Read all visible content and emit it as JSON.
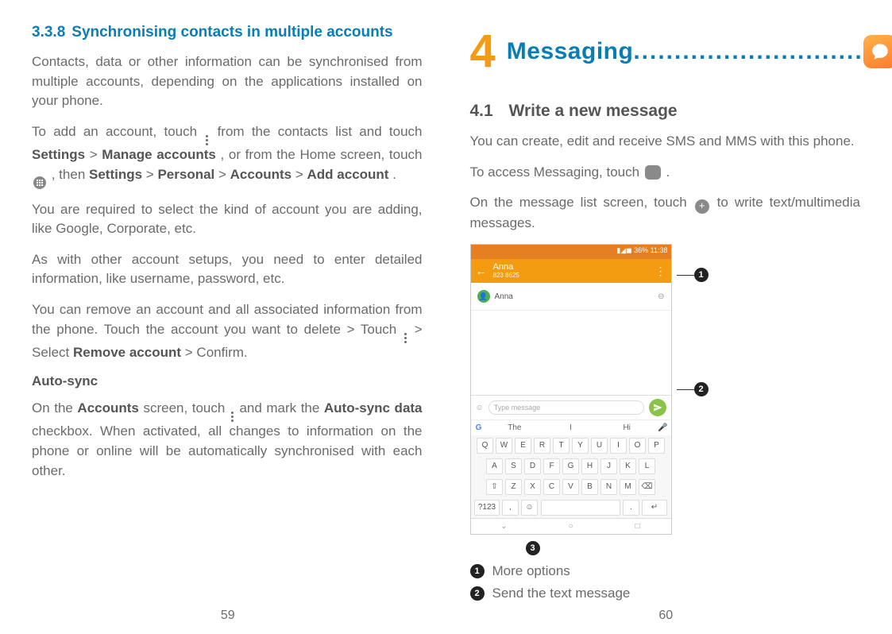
{
  "left": {
    "section_number": "3.3.8",
    "section_title": "Synchronising contacts in multiple accounts",
    "p1": "Contacts, data or other information can be synchronised from multiple accounts, depending on the applications installed on your phone.",
    "p2a": "To add an account, touch ",
    "p2b": " from the contacts list and touch ",
    "p2_settings": "Settings",
    "p2_gt1": " > ",
    "p2_manage": "Manage accounts",
    "p2c": ", or from the Home screen, touch ",
    "p2d": ", then ",
    "p2_settings2": "Settings",
    "p2_gt2": " > ",
    "p2_personal": "Personal",
    "p2_gt3": " > ",
    "p2_accounts": "Accounts",
    "p2_gt4": " > ",
    "p2_add": "Add account",
    "p2_end": ".",
    "p3": "You are required to select the kind of account you are adding, like Google, Corporate, etc.",
    "p4": "As with other account setups, you need to enter detailed information, like username, password, etc.",
    "p5a": "You can remove an account and all associated information from the phone. Touch the account you want to delete > Touch ",
    "p5b": " > Select ",
    "p5_remove": "Remove account",
    "p5c": " > Confirm.",
    "autosync_title": "Auto-sync",
    "p6a": "On the ",
    "p6_accounts": "Accounts",
    "p6b": " screen, touch ",
    "p6c": " and mark the ",
    "p6_autosync": "Auto-sync data",
    "p6d": " checkbox. When activated, all changes to information on the phone or online will be automatically synchronised with each other.",
    "page_num": "59"
  },
  "right": {
    "chapter_num": "4",
    "chapter_title": "Messaging",
    "chapter_dots": "............................",
    "sub_num": "4.1",
    "sub_title": "Write a new message",
    "p1": "You can create, edit and receive SMS and MMS with this phone.",
    "p2a": "To access Messaging, touch ",
    "p2b": ".",
    "p3a": "On the message list screen, touch ",
    "p3b": " to write text/multimedia messages.",
    "callout1": "1",
    "callout2": "2",
    "callout3": "3",
    "legend1_num": "1",
    "legend1_text": "More options",
    "legend2_num": "2",
    "legend2_text": "Send the text message",
    "page_num": "60",
    "mock": {
      "status_time": "▮◢◼ 36% 11:38",
      "contact_name": "Anna",
      "contact_phone": "823 8625",
      "chip_name": "Anna",
      "input_placeholder": "Type message",
      "sugg1": "The",
      "sugg2": "I",
      "sugg3": "Hi",
      "row1": [
        "Q",
        "W",
        "E",
        "R",
        "T",
        "Y",
        "U",
        "I",
        "O",
        "P"
      ],
      "row2": [
        "A",
        "S",
        "D",
        "F",
        "G",
        "H",
        "J",
        "K",
        "L"
      ],
      "row3": [
        "⇧",
        "Z",
        "X",
        "C",
        "V",
        "B",
        "N",
        "M",
        "⌫"
      ],
      "row4_sym": "?123",
      "row4_comma": ",",
      "row4_emoji": "☺",
      "row4_dot": ".",
      "row4_ret": "↵"
    }
  }
}
